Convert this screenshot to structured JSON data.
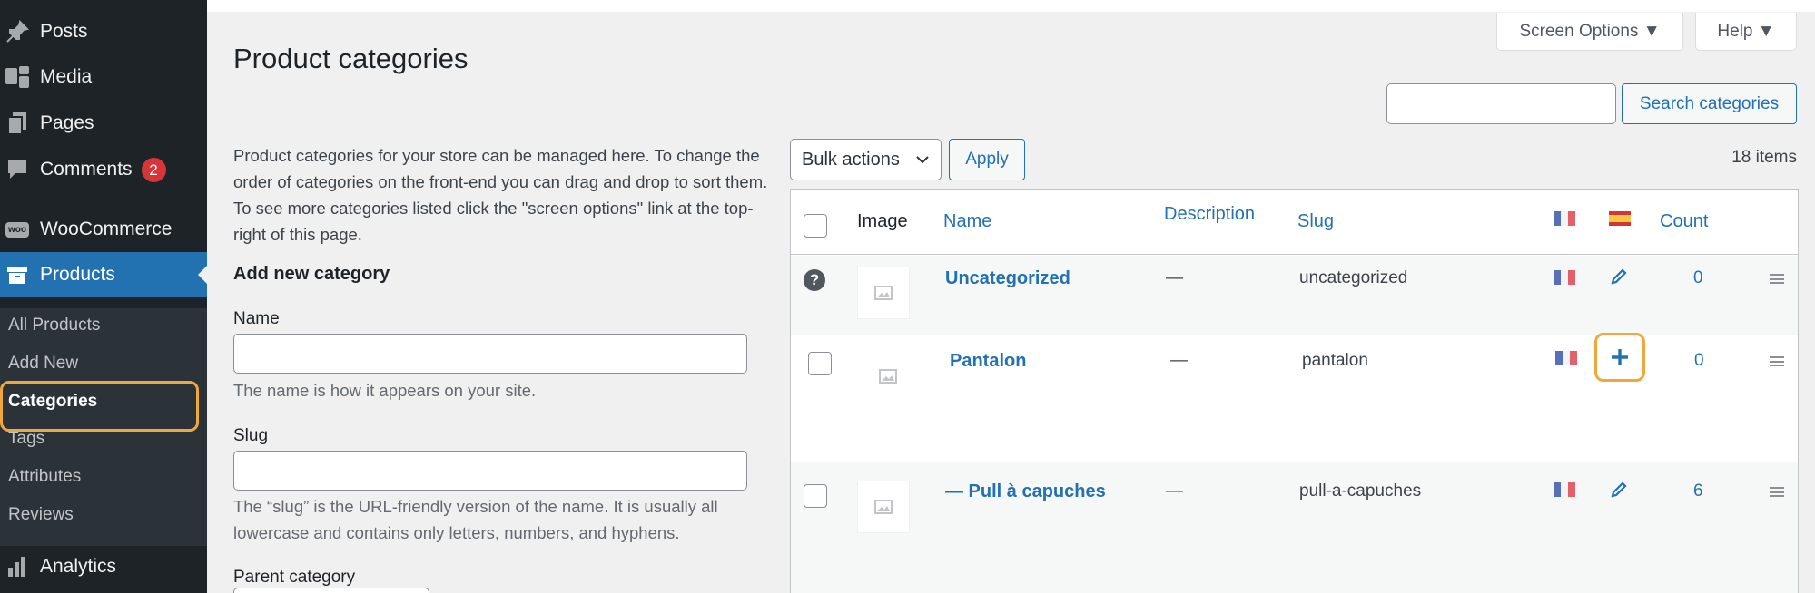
{
  "sidebar": {
    "items": [
      {
        "label": "Posts",
        "icon": "pin-icon"
      },
      {
        "label": "Media",
        "icon": "media-icon"
      },
      {
        "label": "Pages",
        "icon": "pages-icon"
      },
      {
        "label": "Comments",
        "icon": "comment-icon",
        "badge": "2"
      },
      {
        "label": "WooCommerce",
        "icon": "woocommerce-icon",
        "icon_text": "woo"
      },
      {
        "label": "Products",
        "icon": "archive-icon"
      },
      {
        "label": "Analytics",
        "icon": "bar-chart-icon"
      }
    ],
    "submenu": [
      "All Products",
      "Add New",
      "Categories",
      "Tags",
      "Attributes",
      "Reviews"
    ]
  },
  "header": {
    "screen_options": "Screen Options ▼",
    "help": "Help ▼",
    "title": "Product categories",
    "search_button": "Search categories",
    "search_value": ""
  },
  "form": {
    "intro": "Product categories for your store can be managed here. To change the order of categories on the front-end you can drag and drop to sort them. To see more categories listed click the \"screen options\" link at the top-right of this page.",
    "section_title": "Add new category",
    "name_label": "Name",
    "name_value": "",
    "name_help": "The name is how it appears on your site.",
    "slug_label": "Slug",
    "slug_value": "",
    "slug_help": "The “slug” is the URL-friendly version of the name. It is usually all lowercase and contains only letters, numbers, and hyphens.",
    "parent_label": "Parent category"
  },
  "toolbar": {
    "bulk_actions": "Bulk actions",
    "apply": "Apply",
    "items_count": "18 items"
  },
  "table": {
    "columns": [
      "Image",
      "Name",
      "Description",
      "Slug",
      "Count"
    ],
    "rows": [
      {
        "name": "Uncategorized",
        "description": "—",
        "slug": "uncategorized",
        "count": "0",
        "es_action": "edit"
      },
      {
        "name": "Pantalon",
        "description": "—",
        "slug": "pantalon",
        "count": "0",
        "es_action": "add"
      },
      {
        "name": "— Pull à capuches",
        "description": "—",
        "slug": "pull-a-capuches",
        "count": "6",
        "es_action": "edit"
      }
    ]
  },
  "colors": {
    "sidebar_bg": "#1d2327",
    "accent": "#2271b1",
    "highlight": "#f0a73c",
    "badge": "#d63638"
  }
}
